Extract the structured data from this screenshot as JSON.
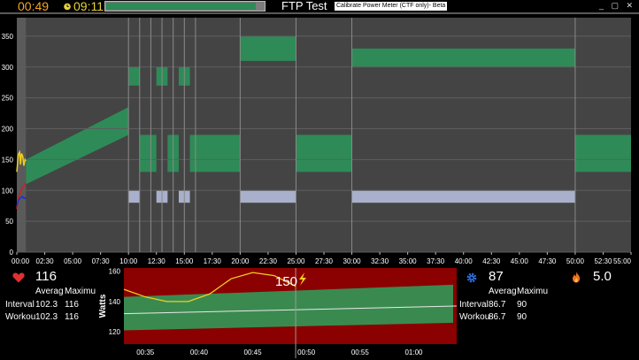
{
  "topbar": {
    "elapsed": "00:49",
    "clock": "09:11",
    "progress": 0.95,
    "title": "FTP Test",
    "calibrate_label": "Calibrate Power Meter (CTF only)- Beta",
    "window_buttons": "_ ▢ ✕"
  },
  "chart_data": {
    "type": "area",
    "y_ticks": [
      "0",
      "50",
      "100",
      "150",
      "200",
      "250",
      "300",
      "350"
    ],
    "x_ticks": [
      "00:00",
      "02:30",
      "05:00",
      "07:30",
      "10:00",
      "12:30",
      "15:00",
      "17:30",
      "20:00",
      "22:30",
      "25:00",
      "27:30",
      "30:00",
      "32:30",
      "35:00",
      "37:30",
      "40:00",
      "42:30",
      "45:00",
      "47:30",
      "50:00",
      "52:30",
      "55:00"
    ],
    "xlim": [
      0,
      3300
    ],
    "ylim": [
      0,
      380
    ],
    "grid": true,
    "played_until": 49,
    "power_zones": [
      {
        "start": 49,
        "end": 600,
        "low0": 110,
        "high0": 150,
        "low1": 190,
        "high1": 235
      },
      {
        "start": 600,
        "end": 660,
        "low": 270,
        "high": 300
      },
      {
        "start": 660,
        "end": 750,
        "low": 130,
        "high": 190
      },
      {
        "start": 750,
        "end": 810,
        "low": 270,
        "high": 300
      },
      {
        "start": 810,
        "end": 870,
        "low": 130,
        "high": 190
      },
      {
        "start": 870,
        "end": 930,
        "low": 270,
        "high": 300
      },
      {
        "start": 930,
        "end": 1200,
        "low": 130,
        "high": 190
      },
      {
        "start": 1200,
        "end": 1500,
        "low": 310,
        "high": 350
      },
      {
        "start": 1500,
        "end": 1800,
        "low": 130,
        "high": 190
      },
      {
        "start": 1800,
        "end": 3000,
        "low": 300,
        "high": 330
      },
      {
        "start": 3000,
        "end": 3300,
        "low": 130,
        "high": 190
      }
    ],
    "cadence_zones": [
      {
        "start": 600,
        "end": 660,
        "low": 80,
        "high": 100
      },
      {
        "start": 750,
        "end": 810,
        "low": 80,
        "high": 100
      },
      {
        "start": 870,
        "end": 930,
        "low": 80,
        "high": 100
      },
      {
        "start": 1200,
        "end": 1500,
        "low": 80,
        "high": 100
      },
      {
        "start": 1800,
        "end": 3000,
        "low": 80,
        "high": 100
      }
    ],
    "segment_lines": [
      600,
      660,
      720,
      780,
      840,
      900,
      960,
      1200,
      1500,
      1800,
      3000
    ],
    "power_line": [
      [
        0,
        130
      ],
      [
        8,
        158
      ],
      [
        15,
        162
      ],
      [
        20,
        142
      ],
      [
        25,
        160
      ],
      [
        32,
        155
      ],
      [
        38,
        140
      ],
      [
        44,
        150
      ],
      [
        49,
        148
      ]
    ],
    "hr_line": [
      [
        0,
        70
      ],
      [
        10,
        88
      ],
      [
        20,
        98
      ],
      [
        30,
        104
      ],
      [
        40,
        108
      ],
      [
        49,
        112
      ]
    ],
    "cadence_line": [
      [
        0,
        75
      ],
      [
        10,
        85
      ],
      [
        20,
        88
      ],
      [
        30,
        90
      ],
      [
        40,
        87
      ],
      [
        49,
        88
      ]
    ]
  },
  "heart": {
    "current": "116",
    "avg_header": "Averag",
    "max_header": "Maximu",
    "rows": [
      {
        "label": "Interval",
        "avg": "102.3",
        "max": "116"
      },
      {
        "label": "Workou",
        "avg": "102.3",
        "max": "116"
      }
    ]
  },
  "cadence": {
    "current": "87",
    "avg_header": "Averag",
    "max_header": "Maximu",
    "rows": [
      {
        "label": "Interval",
        "avg": "86.7",
        "max": "90"
      },
      {
        "label": "Workou",
        "avg": "86.7",
        "max": "90"
      }
    ]
  },
  "calories": {
    "current": "5.0"
  },
  "mini_chart": {
    "ylabel": "Watts",
    "current_power": "150",
    "y_ticks": [
      "120",
      "140",
      "160"
    ],
    "x_ticks": [
      "00:35",
      "00:40",
      "00:45",
      "00:50",
      "00:55",
      "01:00"
    ],
    "xlim": [
      33,
      64
    ],
    "ylim": [
      112,
      162
    ],
    "now": 49,
    "target_band": {
      "low0": 121,
      "high0": 143,
      "low1": 126,
      "high1": 151
    },
    "target_line": [
      [
        33,
        132
      ],
      [
        64,
        137
      ]
    ],
    "power_line": [
      [
        33,
        148
      ],
      [
        35,
        143
      ],
      [
        37,
        140
      ],
      [
        39,
        140
      ],
      [
        41,
        145
      ],
      [
        43,
        155
      ],
      [
        45,
        159
      ],
      [
        47,
        157
      ],
      [
        49,
        150
      ]
    ]
  },
  "colors": {
    "zone_green": "#2e8b57",
    "cadence_band": "#a9b0cc",
    "bg_plot": "#444444",
    "red_band": "#8b0000",
    "power_yellow": "#f0d020"
  }
}
